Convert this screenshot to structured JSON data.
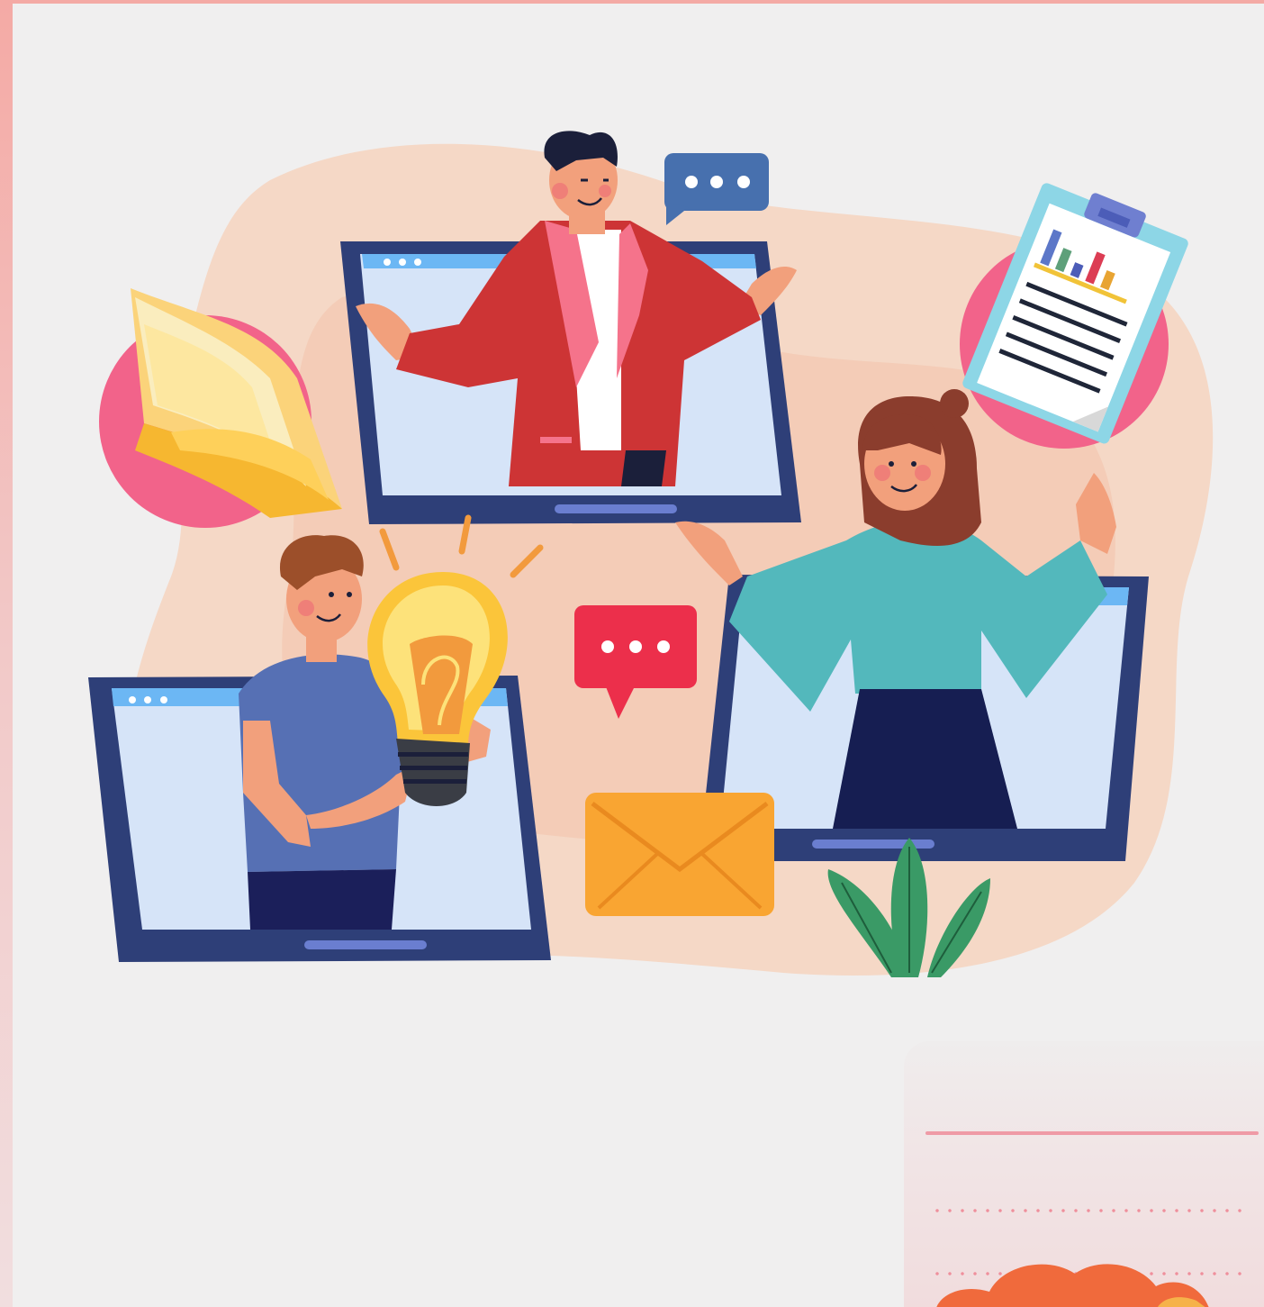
{
  "scene": {
    "colors": {
      "background": "#f0efef",
      "blob": "#f5d8c6",
      "laptop_frame": "#2e3f78",
      "laptop_screen": "#d6e4f8",
      "accent_pink": "#f2638a",
      "bubble_blue": "#4770ae",
      "bubble_red": "#ec2f4b",
      "envelope": "#f9a532",
      "plant": "#3a9a66",
      "bulb": "#fbc53a"
    },
    "figures": [
      "presenter-man-red-jacket",
      "woman-teal-sweater",
      "man-holding-lightbulb"
    ],
    "icons": [
      "open-book-icon",
      "clipboard-chart-icon",
      "chat-bubble-icon",
      "chat-bubble-icon",
      "envelope-icon",
      "lightbulb-icon",
      "plant-icon"
    ]
  }
}
